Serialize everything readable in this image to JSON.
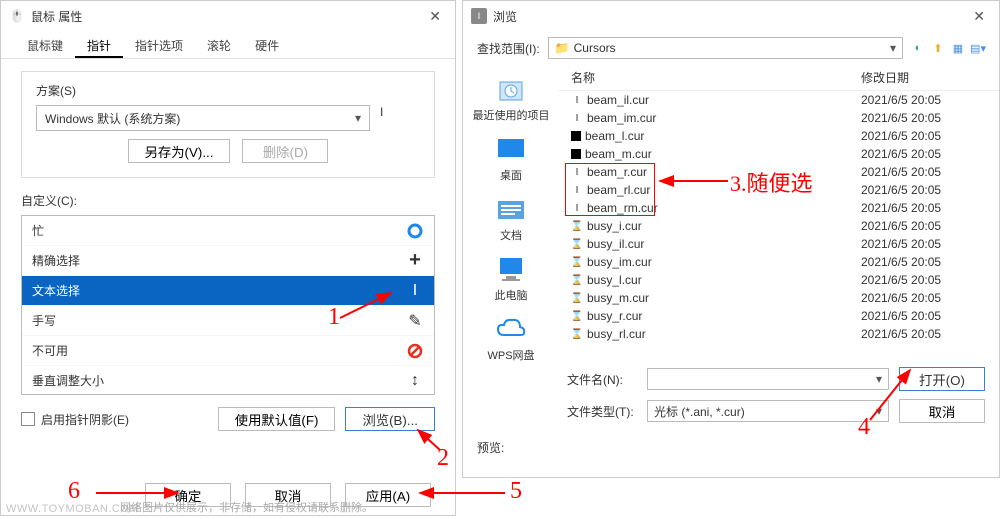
{
  "left": {
    "title": "鼠标 属性",
    "tabs": [
      "鼠标键",
      "指针",
      "指针选项",
      "滚轮",
      "硬件"
    ],
    "active_tab": 1,
    "scheme_label": "方案(S)",
    "scheme_value": "Windows 默认 (系统方案)",
    "save_as": "另存为(V)...",
    "delete": "删除(D)",
    "custom_label": "自定义(C):",
    "cursors": [
      {
        "name": "忙",
        "icon": "circle"
      },
      {
        "name": "精确选择",
        "icon": "plus"
      },
      {
        "name": "文本选择",
        "icon": "ibeam",
        "selected": true
      },
      {
        "name": "手写",
        "icon": "pen"
      },
      {
        "name": "不可用",
        "icon": "forbid"
      },
      {
        "name": "垂直调整大小",
        "icon": "vresize"
      }
    ],
    "shadow_check": "启用指针阴影(E)",
    "use_default": "使用默认值(F)",
    "browse": "浏览(B)...",
    "ok": "确定",
    "cancel": "取消",
    "apply": "应用(A)"
  },
  "right": {
    "title": "浏览",
    "lookup_label": "查找范围(I):",
    "lookup_value": "Cursors",
    "places": [
      {
        "label": "最近使用的项目",
        "icon": "recent"
      },
      {
        "label": "桌面",
        "icon": "desktop"
      },
      {
        "label": "文档",
        "icon": "docs"
      },
      {
        "label": "此电脑",
        "icon": "pc"
      },
      {
        "label": "WPS网盘",
        "icon": "cloud"
      }
    ],
    "col_name": "名称",
    "col_date": "修改日期",
    "files": [
      {
        "name": "beam_il.cur",
        "date": "2021/6/5 20:05",
        "icon": "ibeam"
      },
      {
        "name": "beam_im.cur",
        "date": "2021/6/5 20:05",
        "icon": "ibeam"
      },
      {
        "name": "beam_l.cur",
        "date": "2021/6/5 20:05",
        "icon": "black"
      },
      {
        "name": "beam_m.cur",
        "date": "2021/6/5 20:05",
        "icon": "black"
      },
      {
        "name": "beam_r.cur",
        "date": "2021/6/5 20:05",
        "icon": "ibeam"
      },
      {
        "name": "beam_rl.cur",
        "date": "2021/6/5 20:05",
        "icon": "ibeam"
      },
      {
        "name": "beam_rm.cur",
        "date": "2021/6/5 20:05",
        "icon": "ibeam"
      },
      {
        "name": "busy_i.cur",
        "date": "2021/6/5 20:05",
        "icon": "busy"
      },
      {
        "name": "busy_il.cur",
        "date": "2021/6/5 20:05",
        "icon": "busy"
      },
      {
        "name": "busy_im.cur",
        "date": "2021/6/5 20:05",
        "icon": "busy"
      },
      {
        "name": "busy_l.cur",
        "date": "2021/6/5 20:05",
        "icon": "busy"
      },
      {
        "name": "busy_m.cur",
        "date": "2021/6/5 20:05",
        "icon": "busy"
      },
      {
        "name": "busy_r.cur",
        "date": "2021/6/5 20:05",
        "icon": "busy"
      },
      {
        "name": "busy_rl.cur",
        "date": "2021/6/5 20:05",
        "icon": "busy"
      }
    ],
    "filename_label": "文件名(N):",
    "filename_value": "",
    "filetype_label": "文件类型(T):",
    "filetype_value": "光标 (*.ani, *.cur)",
    "open": "打开(O)",
    "cancel": "取消",
    "preview": "预览:"
  },
  "annotations": {
    "n1": "1",
    "n2": "2",
    "n3": "3.随便选",
    "n4": "4",
    "n5": "5",
    "n6": "6"
  },
  "watermark": "WWW.TOYMOBAN.COM",
  "caption": "网络图片仅供展示，非存储，如有侵权请联系删除。"
}
